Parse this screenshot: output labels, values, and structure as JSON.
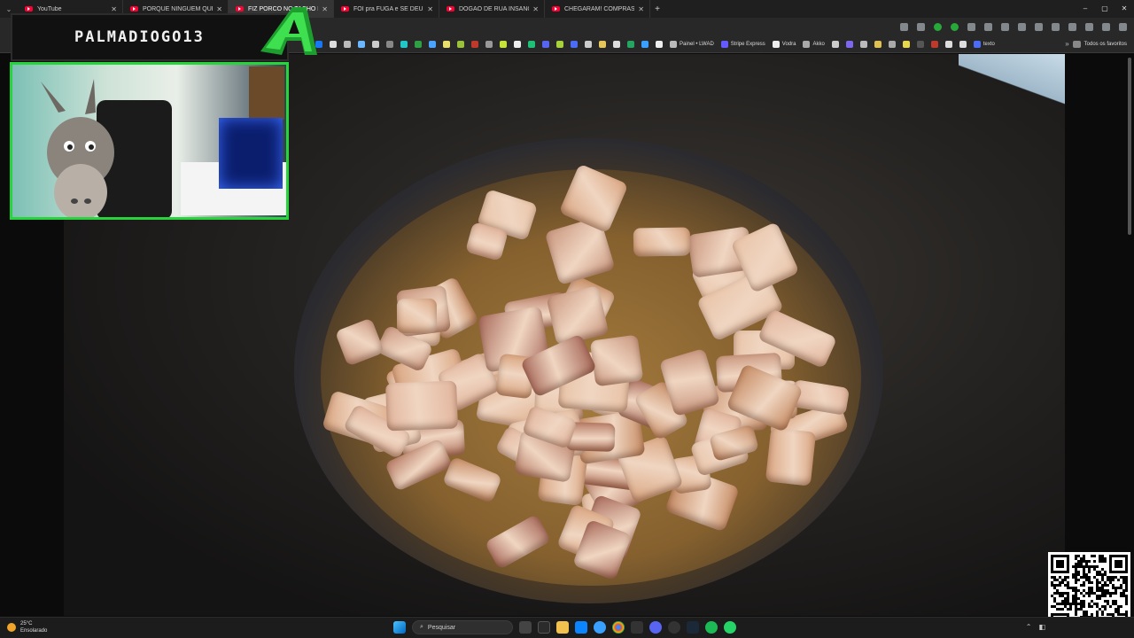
{
  "browser": {
    "tabs": [
      {
        "title": "YouTube",
        "active": false
      },
      {
        "title": "PORQUE NINGUÉM QUER VIR",
        "active": false
      },
      {
        "title": "FIZ PORCO NO TACHO PE...",
        "active": true
      },
      {
        "title": "FOI pra FUGA e SE DEU MAL -",
        "active": false
      },
      {
        "title": "DOGÃO DE RUA INSANO...\"Q...",
        "active": false
      },
      {
        "title": "CHEGARAM! COMPRAS DA SH...",
        "active": false
      }
    ],
    "new_tab": "+",
    "window_controls": {
      "minimize": "–",
      "maximize": "▢",
      "close": "✕"
    },
    "bookmarks": {
      "items": [
        "Painel • LWAD",
        "Stripe Express",
        "Vodra",
        "Akko",
        "texto"
      ],
      "all_favorites": "Todos os favoritos"
    }
  },
  "stream_overlay": {
    "channel_name": "PALMADIOGO13"
  },
  "taskbar": {
    "weather_temp": "25°C",
    "weather_desc": "Ensolarado",
    "search_placeholder": "Pesquisar"
  },
  "colors": {
    "accent_green": "#27d43b",
    "youtube_red": "#ff0033"
  }
}
